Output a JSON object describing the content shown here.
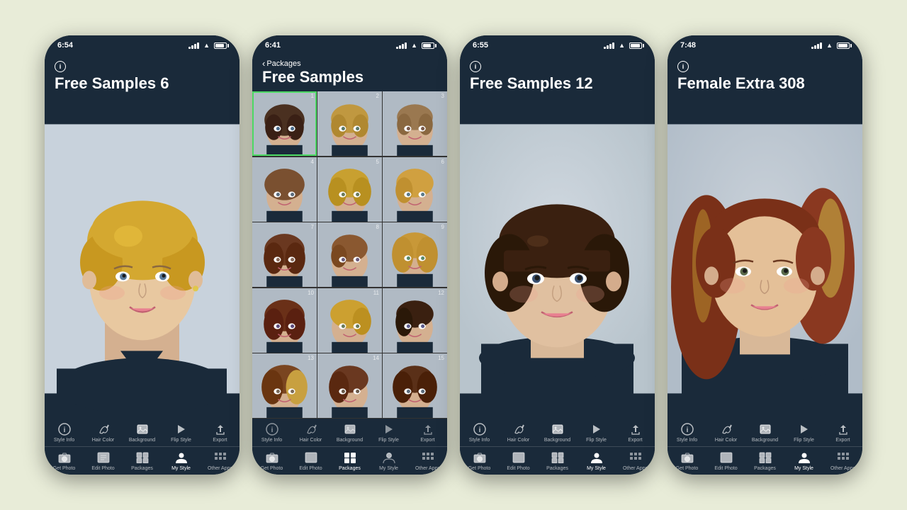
{
  "background": "#e8ecd8",
  "phones": [
    {
      "id": "phone1",
      "time": "6:54",
      "title": "Free Samples 6",
      "hasBackBtn": false,
      "hasInfoIcon": true,
      "activeTab": "my-style",
      "hairType": "blonde-short",
      "description": "Blonde short pixie cut woman"
    },
    {
      "id": "phone2",
      "time": "6:41",
      "title": "Free Samples",
      "hasBackBtn": true,
      "backLabel": "Packages",
      "hasInfoIcon": false,
      "activeTab": "packages",
      "description": "Grid of hair style thumbnails"
    },
    {
      "id": "phone3",
      "time": "6:55",
      "title": "Free Samples 12",
      "hasBackBtn": false,
      "hasInfoIcon": true,
      "activeTab": "my-style",
      "hairType": "dark-bob",
      "description": "Dark bob cut woman"
    },
    {
      "id": "phone4",
      "time": "7:48",
      "title": "Female Extra 308",
      "hasBackBtn": false,
      "hasInfoIcon": true,
      "activeTab": "my-style",
      "hairType": "auburn-long",
      "description": "Auburn long hair woman"
    }
  ],
  "toolbar": {
    "topItems": [
      {
        "id": "style-info",
        "label": "Style Info",
        "icon": "info"
      },
      {
        "id": "hair-color",
        "label": "Hair Color",
        "icon": "bucket"
      },
      {
        "id": "background",
        "label": "Background",
        "icon": "photo"
      },
      {
        "id": "flip-style",
        "label": "Flip Style",
        "icon": "flip"
      },
      {
        "id": "export",
        "label": "Export",
        "icon": "share"
      }
    ],
    "bottomItems": [
      {
        "id": "get-photo",
        "label": "Get Photo",
        "icon": "camera"
      },
      {
        "id": "edit-photo",
        "label": "Edit Photo",
        "icon": "edit"
      },
      {
        "id": "packages",
        "label": "Packages",
        "icon": "packages"
      },
      {
        "id": "my-style",
        "label": "My Style",
        "icon": "person",
        "active": true
      },
      {
        "id": "other-apps",
        "label": "Other Apps",
        "icon": "grid"
      }
    ]
  }
}
